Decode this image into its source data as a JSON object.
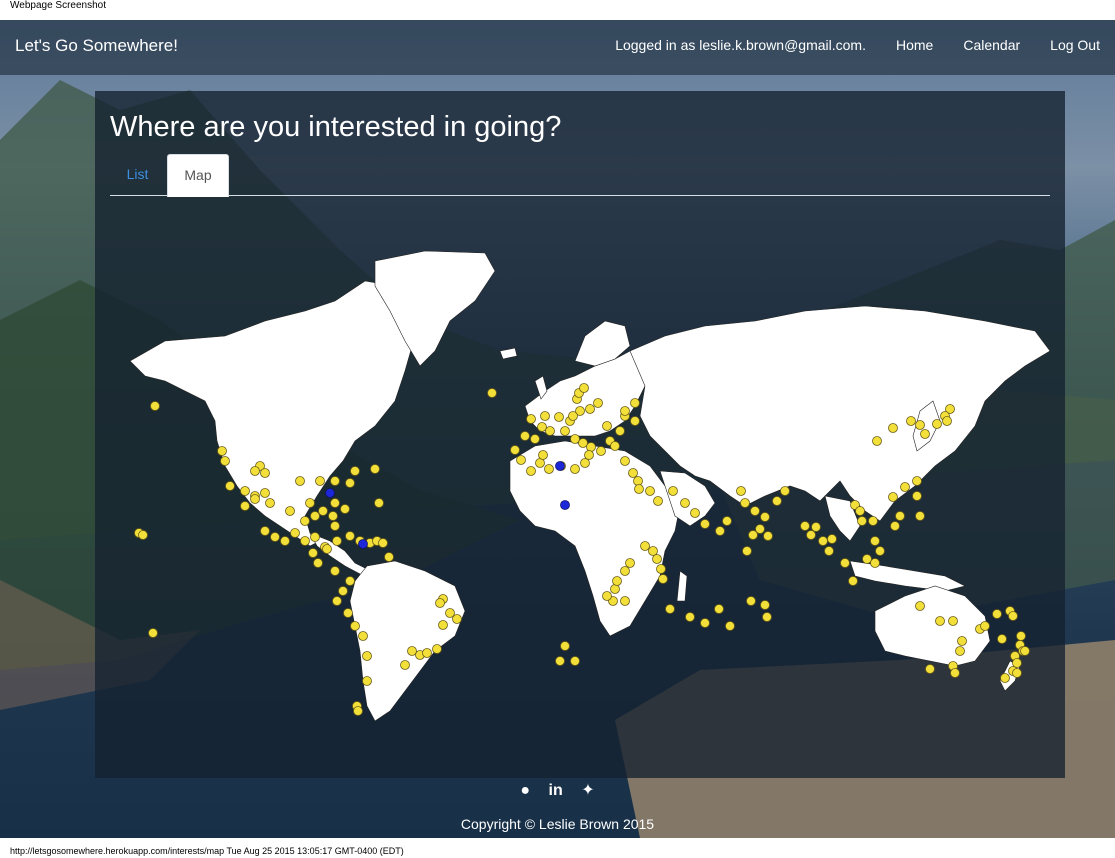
{
  "print": {
    "header": "Webpage Screenshot",
    "footer": "http://letsgosomewhere.herokuapp.com/interests/map Tue Aug 25 2015 13:05:17 GMT-0400 (EDT)"
  },
  "navbar": {
    "brand": "Let's Go Somewhere!",
    "logged_in": "Logged in as leslie.k.brown@gmail.com.",
    "links": [
      "Home",
      "Calendar",
      "Log Out"
    ]
  },
  "page": {
    "title": "Where are you interested in going?",
    "tabs": [
      {
        "label": "List",
        "active": false
      },
      {
        "label": "Map",
        "active": true
      }
    ]
  },
  "map": {
    "marker_colors": {
      "interest": "#f2df3a",
      "highlight": "#1c28d8"
    }
  },
  "footer": {
    "icons": [
      "github-icon",
      "linkedin-icon",
      "twitter-icon"
    ],
    "copyright": "Copyright © Leslie Brown 2015"
  }
}
